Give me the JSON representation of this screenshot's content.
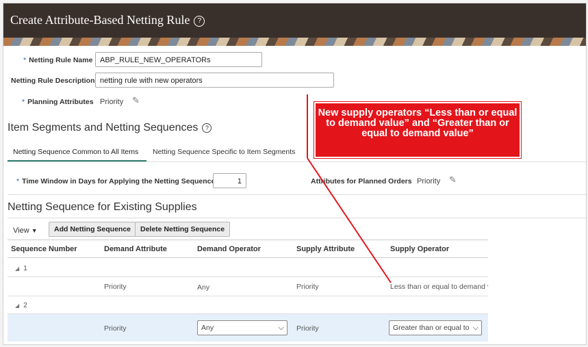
{
  "header": {
    "title": "Create Attribute-Based Netting Rule",
    "help_icon": "?"
  },
  "form": {
    "name_label": "Netting Rule Name",
    "name_value": "ABP_RULE_NEW_OPERATORs",
    "desc_label": "Netting Rule Description",
    "desc_value": "netting rule with new operators",
    "attributes_label": "Planning Attributes",
    "attributes_value": "Priority",
    "required_mark": "*"
  },
  "segments": {
    "title": "Item Segments and Netting Sequences",
    "tabs": [
      {
        "label": "Netting Sequence Common to All Items",
        "active": true
      },
      {
        "label": "Netting Sequence Specific to Item Segments",
        "active": false
      }
    ],
    "time_window_label": "Time Window in Days for Applying the Netting Sequence",
    "time_window_value": "1",
    "planned_orders_label": "Attributes for Planned Orders",
    "planned_orders_value": "Priority"
  },
  "supplies": {
    "title": "Netting Sequence for Existing Supplies",
    "view_label": "View",
    "add_button": "Add Netting Sequence",
    "delete_button": "Delete Netting Sequence",
    "columns": [
      "Sequence Number",
      "Demand Attribute",
      "Demand Operator",
      "Supply Attribute",
      "Supply Operator"
    ],
    "rows": [
      {
        "seq": "1",
        "demand_attr": "Priority",
        "demand_op": "Any",
        "supply_attr": "Priority",
        "supply_op": "Less than or equal to demand v"
      },
      {
        "seq": "2",
        "demand_attr": "Priority",
        "demand_op": "Any",
        "supply_attr": "Priority",
        "supply_op": "Greater than or equal to"
      }
    ]
  },
  "callout": {
    "text": "New supply operators “Less than or equal to demand value” and “Greater than or equal to demand value”",
    "color": "#e3151b"
  }
}
